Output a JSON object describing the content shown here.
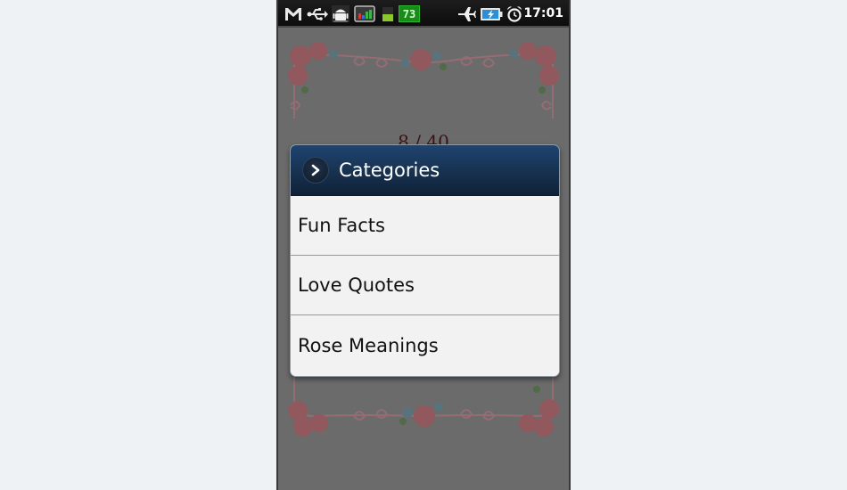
{
  "status_bar": {
    "time": "17:01",
    "battery_small_label": "73",
    "icons": [
      "gmail-icon",
      "usb-icon",
      "android-debug-icon",
      "chart-app-icon",
      "signal-bar-icon",
      "battery-percent-icon",
      "airplane-mode-icon",
      "battery-charging-icon",
      "alarm-clock-icon"
    ]
  },
  "background": {
    "counter": "8 / 40"
  },
  "dialog": {
    "title": "Categories",
    "header_icon": "chevron-right-icon",
    "items": [
      {
        "label": "Fun Facts"
      },
      {
        "label": "Love Quotes"
      },
      {
        "label": "Rose Meanings"
      }
    ]
  },
  "colors": {
    "page_bg": "#eef2f5",
    "dim_screen": "#6b6b6b",
    "dialog_header": "#17314f",
    "dialog_body": "#f2f2f2",
    "counter_text": "#3c1216"
  }
}
